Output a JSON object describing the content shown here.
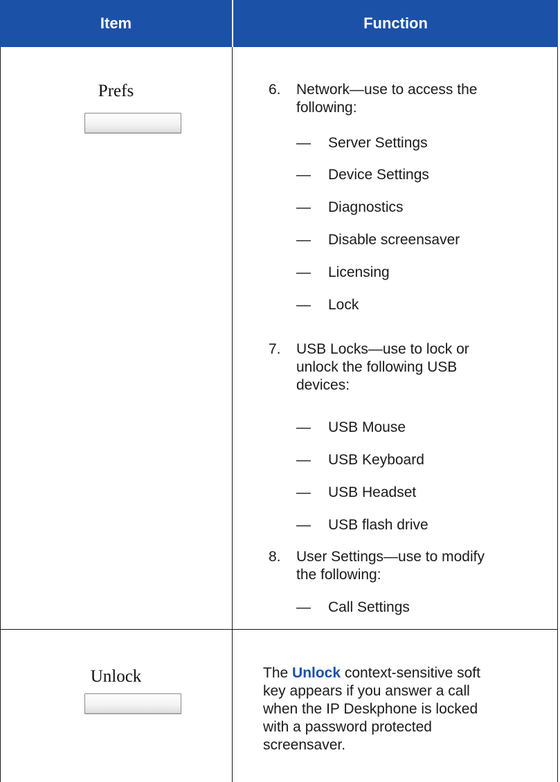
{
  "header": {
    "item_label": "Item",
    "function_label": "Function"
  },
  "row1": {
    "softkey_label": "Prefs",
    "items": [
      {
        "number": "6.",
        "text_line1": "Network—use to access the",
        "text_line2": "following:",
        "subitems": [
          "Server Settings",
          "Device Settings",
          "Diagnostics",
          "Disable screensaver",
          "Licensing",
          "Lock"
        ]
      },
      {
        "number": "7.",
        "text_line1": "USB Locks—use to lock or",
        "text_line2": "unlock the following USB",
        "text_line3": "devices:",
        "subitems": [
          "USB Mouse",
          "USB Keyboard",
          "USB Headset",
          "USB flash drive"
        ]
      },
      {
        "number": "8.",
        "text_line1": "User Settings—use to modify",
        "text_line2": "the following:",
        "subitems": [
          "Call Settings"
        ]
      }
    ],
    "dash": "—"
  },
  "row2": {
    "softkey_label": "Unlock",
    "desc_prefix": "The ",
    "desc_keyword": "Unlock",
    "desc_line1_rest": " context-sensitive soft",
    "desc_line2": "key appears if you answer a call",
    "desc_line3": "when the IP Deskphone is locked",
    "desc_line4": "with a password protected",
    "desc_line5": "screensaver."
  },
  "colors": {
    "header_bg": "#1c51a8",
    "keyword": "#1c51a8"
  }
}
